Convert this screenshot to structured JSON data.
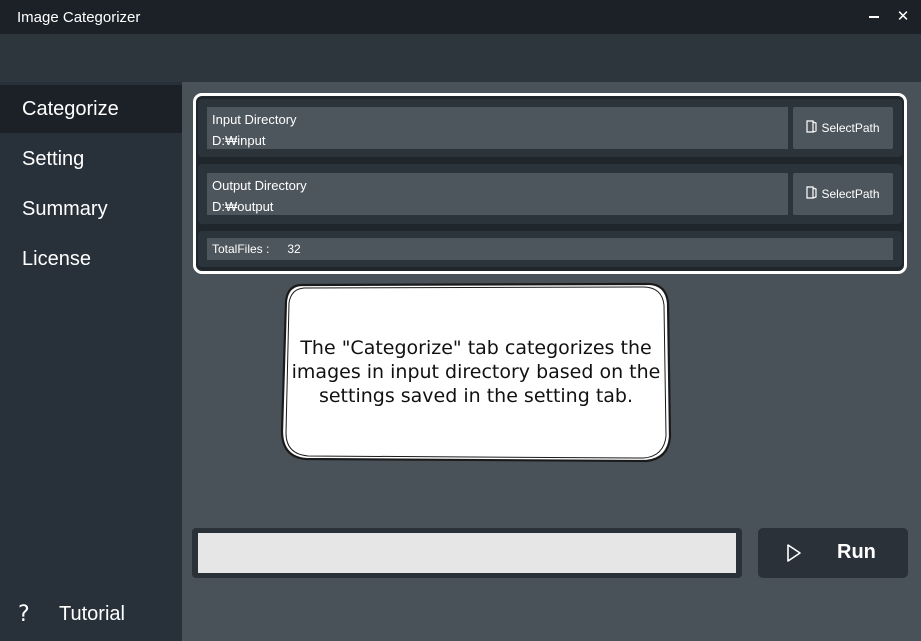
{
  "window": {
    "title": "Image Categorizer",
    "minimize_icon": "minimize-icon",
    "close_label": "✕"
  },
  "sidebar": {
    "items": [
      {
        "label": "Categorize",
        "active": true
      },
      {
        "label": "Setting",
        "active": false
      },
      {
        "label": "Summary",
        "active": false
      },
      {
        "label": "License",
        "active": false
      }
    ],
    "tutorial": {
      "icon": "?",
      "label": "Tutorial"
    }
  },
  "categorize": {
    "input": {
      "label": "Input Directory",
      "value": "D:₩input",
      "button": "SelectPath"
    },
    "output": {
      "label": "Output Directory",
      "value": "D:₩output",
      "button": "SelectPath"
    },
    "total": {
      "label": "TotalFiles :",
      "value": "32"
    }
  },
  "tutorial_callout": {
    "text": "The \"Categorize\" tab categorizes the images in input directory based on the settings saved in the setting tab."
  },
  "progress": {
    "value": 0
  },
  "run": {
    "label": "Run",
    "icon": "play-icon"
  },
  "colors": {
    "titlebar": "#1b2127",
    "sidebar": "#28303a",
    "content": "#4a5259",
    "field": "#4e565d",
    "panel_border": "#ffffff"
  }
}
